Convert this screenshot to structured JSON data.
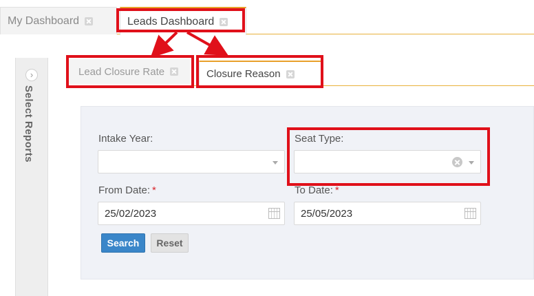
{
  "top_tabs": [
    {
      "label": "My Dashboard",
      "active": false
    },
    {
      "label": "Leads Dashboard",
      "active": true
    }
  ],
  "sub_tabs": [
    {
      "label": "Lead Closure Rate",
      "active": false
    },
    {
      "label": "Closure Reason",
      "active": true
    }
  ],
  "sidebar": {
    "toggle_glyph": "›",
    "label": "Select Reports"
  },
  "form": {
    "intake_year": {
      "label": "Intake Year:",
      "value": ""
    },
    "seat_type": {
      "label": "Seat Type:",
      "value": ""
    },
    "from_date": {
      "label": "From Date:",
      "required_mark": "*",
      "value": "25/02/2023"
    },
    "to_date": {
      "label": "To Date:",
      "required_mark": "*",
      "value": "25/05/2023"
    },
    "search_label": "Search",
    "reset_label": "Reset"
  },
  "colors": {
    "accent": "#e8a02a",
    "highlight": "#e0101a",
    "primary_button": "#3a86c9"
  }
}
